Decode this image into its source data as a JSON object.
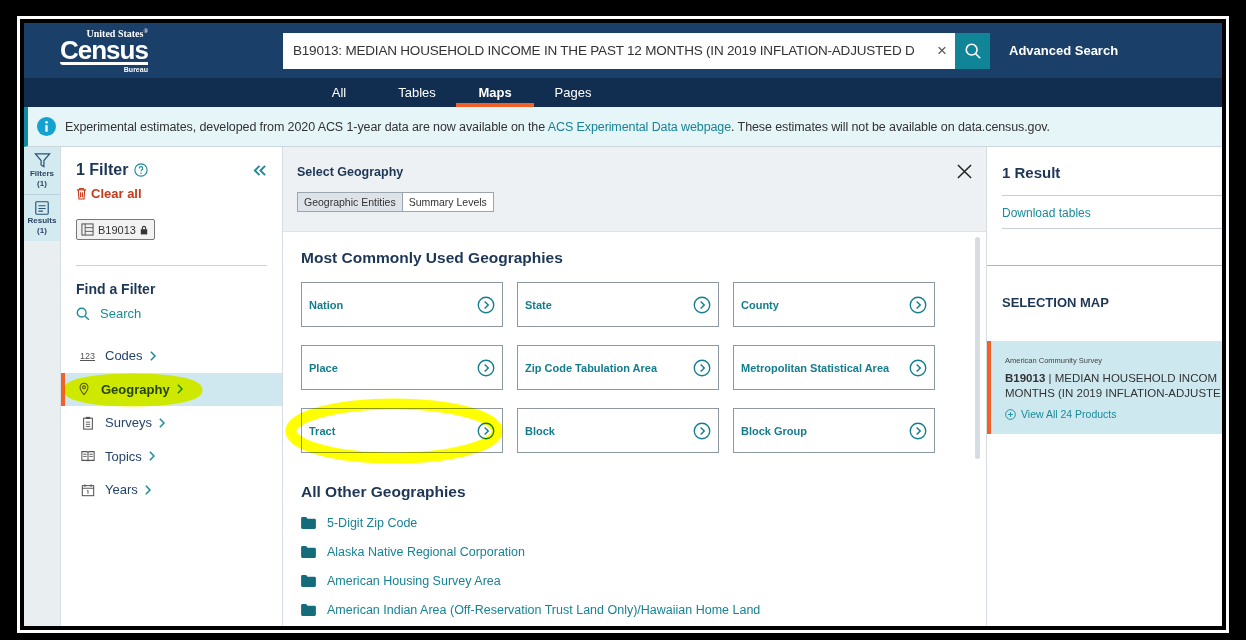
{
  "header": {
    "logo": {
      "top": "United States$^{®}$",
      "main": "Census",
      "bottom": "Bureau"
    },
    "search": {
      "value": "B19013: MEDIAN HOUSEHOLD INCOME IN THE PAST 12 MONTHS (IN 2019 INFLATION-ADJUSTED D",
      "clear": "×"
    },
    "advanced_search": "Advanced Search"
  },
  "tabs": [
    {
      "label": "All",
      "selected": false
    },
    {
      "label": "Tables",
      "selected": false
    },
    {
      "label": "Maps",
      "selected": true
    },
    {
      "label": "Pages",
      "selected": false
    }
  ],
  "banner": {
    "text_before": "Experimental estimates, developed from 2020 ACS 1-year data are now available on the ",
    "link": "ACS Experimental Data webpage",
    "text_after": ". These estimates will not be available on data.census.gov."
  },
  "rail": [
    {
      "kind": "filters",
      "label": "Filters",
      "count": "(1)"
    },
    {
      "kind": "results",
      "label": "Results",
      "count": "(1)"
    }
  ],
  "filter_panel": {
    "title": "1 Filter",
    "clear_all": "Clear all",
    "chips": [
      {
        "label": "B19013",
        "locked": true
      }
    ],
    "find_title": "Find a Filter",
    "search": "Search",
    "items": [
      {
        "kind": "codes",
        "icon_text": "123",
        "label": "Codes",
        "selected": false,
        "highlighted": false
      },
      {
        "kind": "geography",
        "label": "Geography",
        "selected": true,
        "highlighted": true
      },
      {
        "kind": "surveys",
        "label": "Surveys",
        "selected": false,
        "highlighted": false
      },
      {
        "kind": "topics",
        "label": "Topics",
        "selected": false,
        "highlighted": false
      },
      {
        "kind": "years",
        "label": "Years",
        "selected": false,
        "highlighted": false
      }
    ]
  },
  "geography": {
    "title": "Select Geography",
    "toggle": [
      {
        "label": "Geographic Entities",
        "selected": true
      },
      {
        "label": "Summary Levels",
        "selected": false
      }
    ],
    "common_title": "Most Commonly Used Geographies",
    "common": [
      {
        "label": "Nation",
        "highlighted": false
      },
      {
        "label": "State",
        "highlighted": false
      },
      {
        "label": "County",
        "highlighted": false
      },
      {
        "label": "Place",
        "highlighted": false
      },
      {
        "label": "Zip Code Tabulation Area",
        "highlighted": false
      },
      {
        "label": "Metropolitan Statistical Area",
        "highlighted": false
      },
      {
        "label": "Tract",
        "highlighted": true
      },
      {
        "label": "Block",
        "highlighted": false
      },
      {
        "label": "Block Group",
        "highlighted": false
      }
    ],
    "other_title": "All Other Geographies",
    "other": [
      "5-Digit Zip Code",
      "Alaska Native Regional Corporation",
      "American Housing Survey Area",
      "American Indian Area (Off-Reservation Trust Land Only)/Hawaiian Home Land"
    ]
  },
  "results": {
    "title": "1 Result",
    "download": "Download tables",
    "map_title": "SELECTION MAP",
    "items": [
      {
        "survey": "American Community Survey",
        "title_lines": [
          "**B19013** | MEDIAN HOUSEHOLD INCOM",
          "MONTHS (IN 2019 INFLATION-ADJUSTE"
        ],
        "more": "View All 24 Products",
        "selected": true
      }
    ]
  }
}
